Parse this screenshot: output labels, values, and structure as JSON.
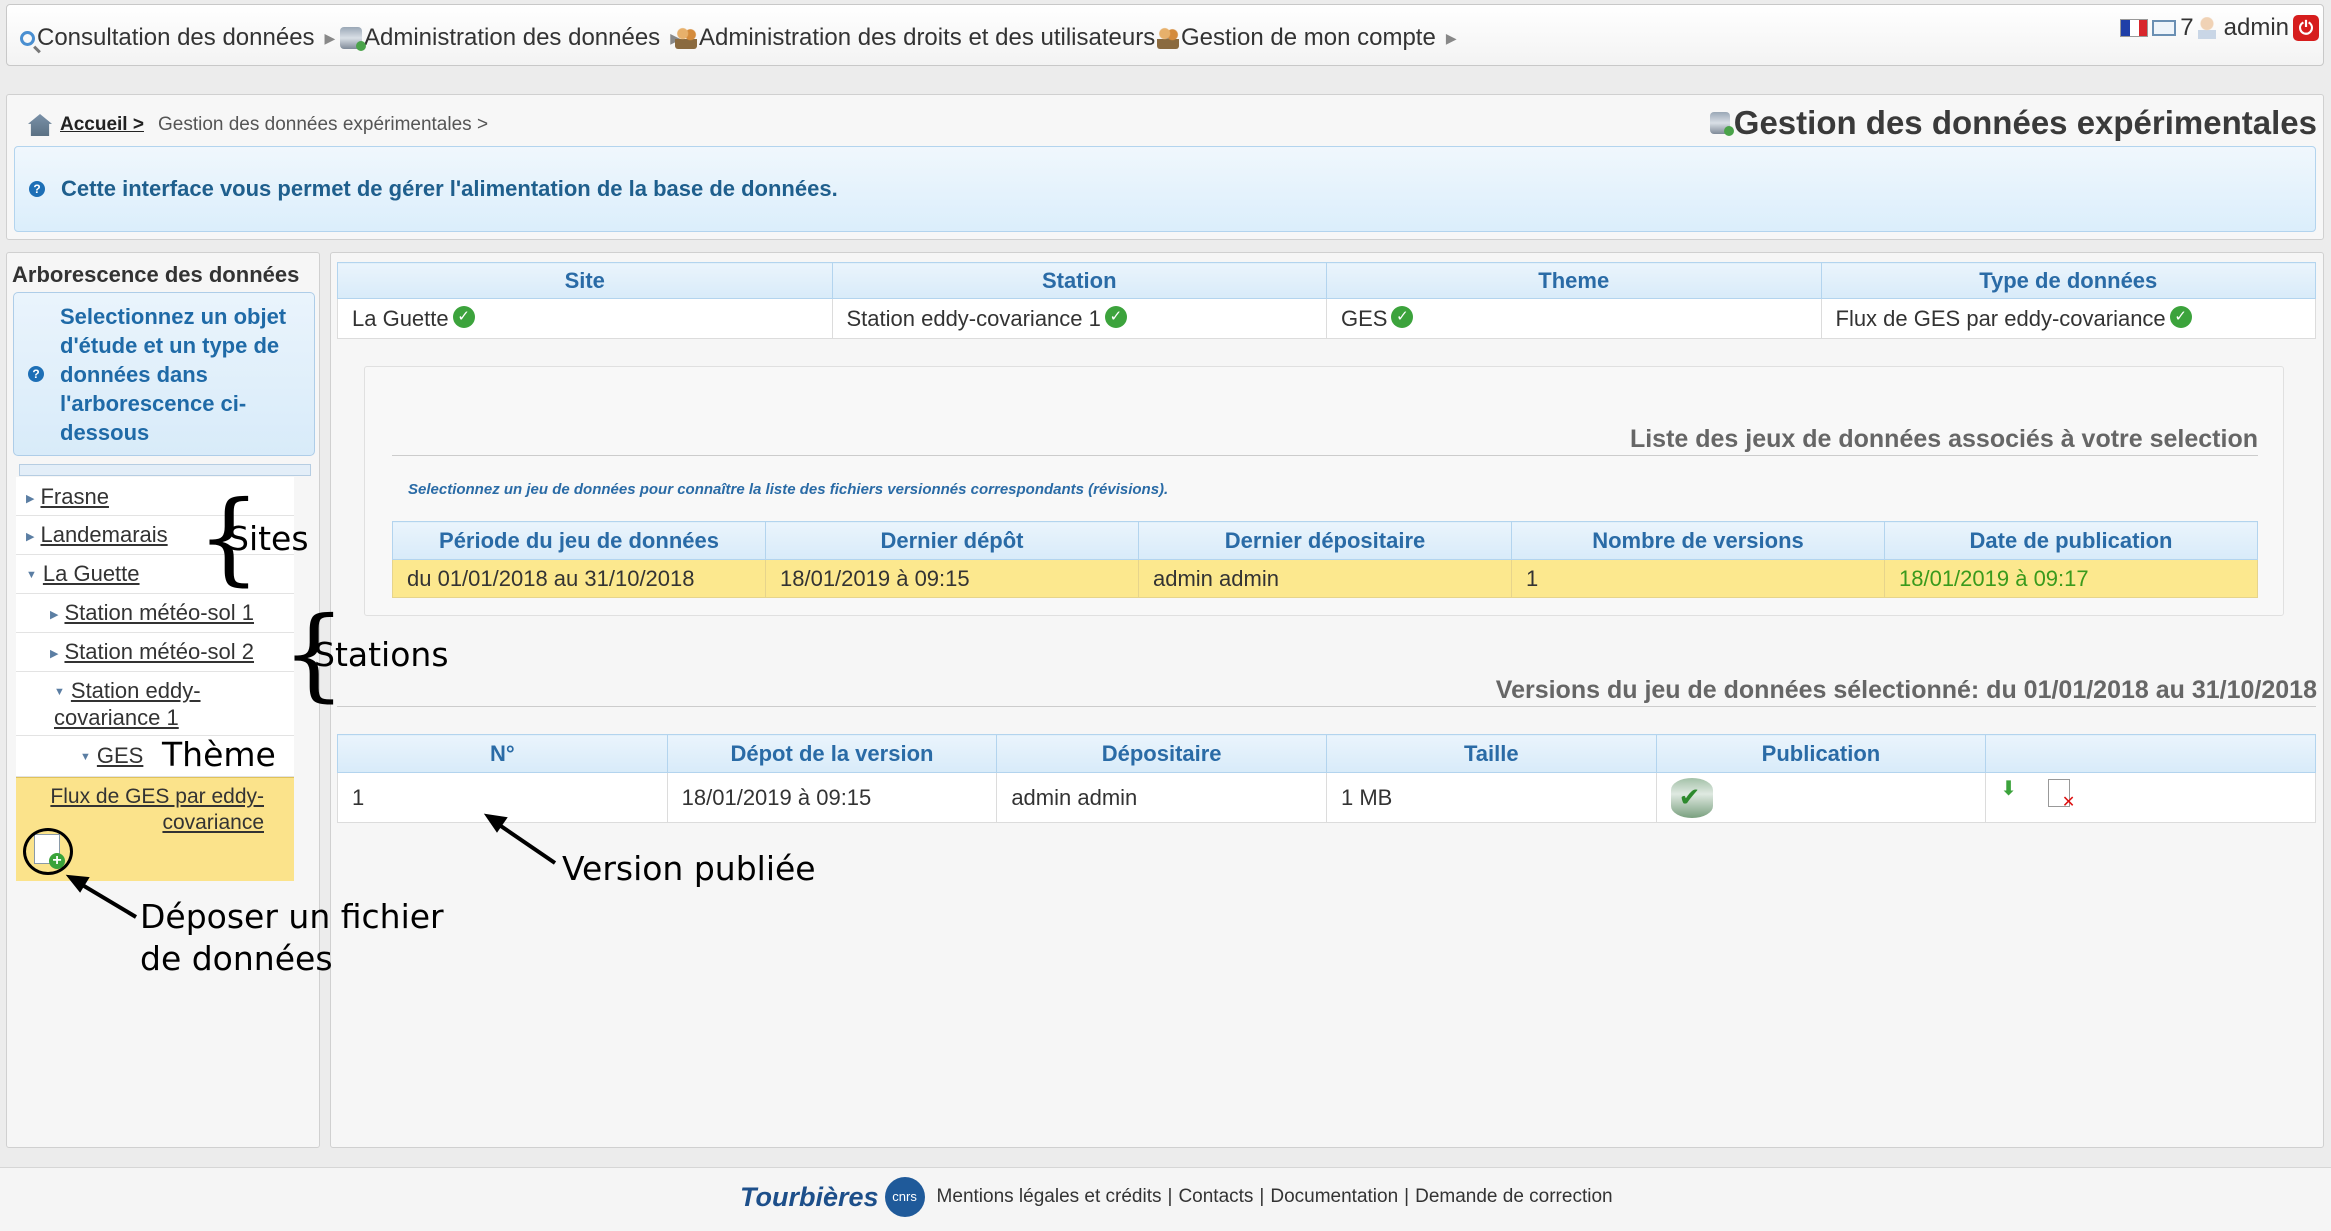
{
  "nav": {
    "items": [
      {
        "label": "Consultation des données"
      },
      {
        "label": "Administration des données"
      },
      {
        "label": "Administration des droits et des utilisateurs"
      },
      {
        "label": "Gestion de mon compte"
      }
    ],
    "message_count": "7",
    "user": "admin"
  },
  "header": {
    "breadcrumb_home": "Accueil >",
    "breadcrumb_current": "Gestion des données expérimentales >",
    "title": "Gestion des données expérimentales",
    "info": "Cette interface vous permet de gérer l'alimentation de la base de données."
  },
  "tree": {
    "title": "Arborescence des données",
    "help": "Selectionnez un objet d'étude et un type de données dans l'arborescence ci-dessous",
    "sites": [
      "Frasne",
      "Landemarais",
      "La Guette"
    ],
    "stations": [
      "Station météo-sol 1",
      "Station météo-sol 2",
      "Station eddy-covariance 1"
    ],
    "theme": "GES",
    "datatype": "Flux de GES par eddy-covariance"
  },
  "selection": {
    "headers": [
      "Site",
      "Station",
      "Theme",
      "Type de données"
    ],
    "values": [
      "La Guette",
      "Station eddy-covariance 1",
      "GES",
      "Flux de GES par eddy-covariance"
    ]
  },
  "datasets": {
    "title": "Liste des jeux de données associés à votre selection",
    "hint": "Selectionnez un jeu de données pour connaître la liste des fichiers versionnés correspondants (révisions).",
    "headers": [
      "Période du jeu de données",
      "Dernier dépôt",
      "Dernier dépositaire",
      "Nombre de versions",
      "Date de publication"
    ],
    "rows": [
      [
        "du 01/01/2018 au 31/10/2018",
        "18/01/2019 à 09:15",
        "admin admin",
        "1",
        "18/01/2019 à 09:17"
      ]
    ]
  },
  "versions": {
    "title": "Versions du jeu de données sélectionné: du 01/01/2018 au 31/10/2018",
    "headers": [
      "N°",
      "Dépot de la version",
      "Dépositaire",
      "Taille",
      "Publication",
      ""
    ],
    "rows": [
      [
        "1",
        "18/01/2019 à 09:15",
        "admin admin",
        "1 MB"
      ]
    ]
  },
  "annotations": {
    "sites": "Sites",
    "stations": "Stations",
    "theme": "Thème",
    "published": "Version publiée",
    "upload_line1": "Déposer un fichier",
    "upload_line2": "de données"
  },
  "footer": {
    "logo": "Tourbières",
    "cnrs": "cnrs",
    "links": [
      "Mentions légales et crédits",
      "Contacts",
      "Documentation",
      "Demande de correction"
    ]
  },
  "colors": {
    "accent": "#2a6ba6",
    "highlight_row": "#fce88e",
    "published_date": "#3a9a1c"
  }
}
